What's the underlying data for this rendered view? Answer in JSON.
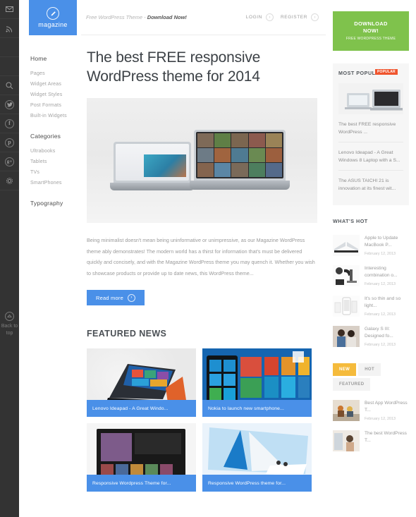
{
  "rail": {
    "icons": [
      {
        "name": "mail-icon",
        "glyph": "✉"
      },
      {
        "name": "rss-icon",
        "glyph": "◔"
      },
      {
        "name": "search-icon",
        "glyph": "⚲"
      },
      {
        "name": "twitter-icon",
        "glyph": "t"
      },
      {
        "name": "facebook-icon",
        "glyph": "f"
      },
      {
        "name": "pinterest-icon",
        "glyph": "p"
      },
      {
        "name": "googleplus-icon",
        "glyph": "g"
      },
      {
        "name": "gear-icon",
        "glyph": "⚙"
      }
    ],
    "back_to_top": "Back to top"
  },
  "logo": {
    "text": "magazine",
    "icon": "pencil-icon"
  },
  "nav": {
    "primary_head": "Home",
    "primary_items": [
      "Pages",
      "Widget Areas",
      "Widget Styles",
      "Post Formats",
      "Built-in Widgets"
    ],
    "categories_head": "Categories",
    "categories_items": [
      "Ultrabooks",
      "Tablets",
      "TVs",
      "SmartPhones"
    ],
    "typography_head": "Typography"
  },
  "topbar": {
    "promo_prefix": "Free WordPress Theme - ",
    "promo_link": "Download Now!",
    "login": "LOGIN",
    "register": "REGISTER"
  },
  "article": {
    "title": "The best FREE responsive WordPress theme for 2014",
    "body": "Being minimalist doesn't mean being uninformative or unimpressive, as our Magazine WordPress theme ably demonstrates! The modern world has a thirst for information that's must be delivered quickly and concisely, and with the Magazine WordPress theme you may quench it. Whether you wish to showcase products or provide up to date news, this WordPress theme...",
    "read_more": "Read more"
  },
  "featured": {
    "title": "FEATURED NEWS",
    "cards": [
      {
        "caption": "Lenovo Ideapad - A Great Windo..."
      },
      {
        "caption": "Nokia to launch new smartphone..."
      },
      {
        "caption": "Responsive Wordpress Theme for..."
      },
      {
        "caption": "Responsive WordPress theme for..."
      }
    ]
  },
  "sidebar": {
    "download": {
      "line1": "DOWNLOAD",
      "line2": "NOW!",
      "line3": "FREE WORDPRESS THEME"
    },
    "most_popular": {
      "heading": "MOST POPULAR",
      "badge": "POPULAR",
      "items": [
        "The best FREE responsive WordPress ...",
        "Lenovo Ideapad - A Great Windows 8 Laptop with a S...",
        "The ASUS TAICHI 21 is innovation at its finest wit..."
      ]
    },
    "whats_hot": {
      "heading": "WHAT'S HOT",
      "items": [
        {
          "title": "Apple to Update MacBook P...",
          "date": "February 12, 2013"
        },
        {
          "title": "Interesting combination o...",
          "date": "February 12, 2013"
        },
        {
          "title": "It's so thin and so light...",
          "date": "February 12, 2013"
        },
        {
          "title": "Galaxy S III: Designed fo...",
          "date": "February 12, 2013"
        }
      ]
    },
    "tabs": {
      "items": [
        "NEW",
        "HOT",
        "FEATURED"
      ],
      "active": "NEW",
      "panel_items": [
        {
          "title": "Best App WordPress T...",
          "date": "February 12, 2013"
        },
        {
          "title": "The best WordPress T...",
          "date": ""
        }
      ]
    }
  },
  "colors": {
    "accent_blue": "#4a90e8",
    "green": "#7fc24c",
    "orange_badge": "#f0552e",
    "tab_active": "#f5bb3c",
    "rail_dark": "#333333"
  }
}
